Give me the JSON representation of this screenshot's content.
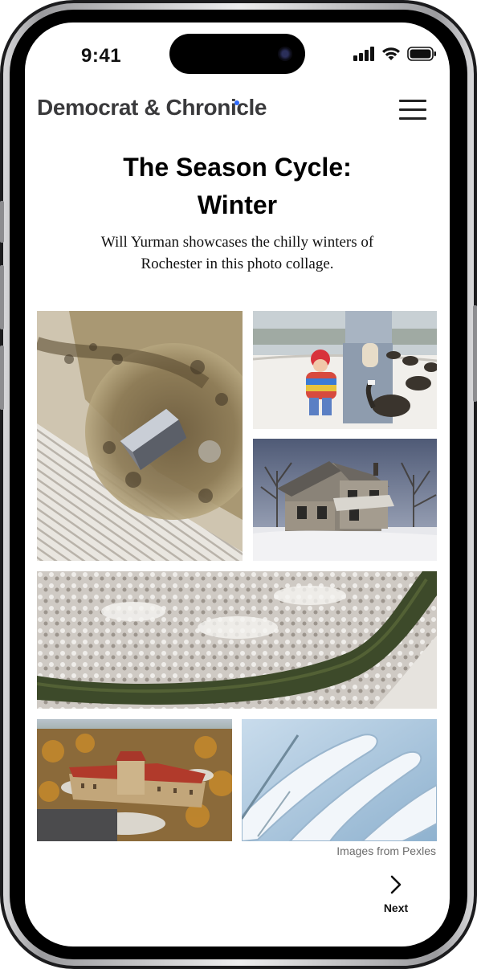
{
  "status_bar": {
    "time": "9:41"
  },
  "header": {
    "brand": "Democrat & Chronicle",
    "menu_icon": "hamburger-menu-icon"
  },
  "article": {
    "title_line1": "The Season Cycle:",
    "title_line2": "Winter",
    "subtitle_line1": "Will Yurman showcases the chilly winters of",
    "subtitle_line2": "Rochester in this photo collage."
  },
  "photos": [
    {
      "name": "aerial-abandoned-farmhouse",
      "subject": "aerial view of abandoned farmhouse in snowy field"
    },
    {
      "name": "child-with-geese",
      "subject": "child in winter coat near geese"
    },
    {
      "name": "old-wooden-house",
      "subject": "weathered wooden house in snow"
    },
    {
      "name": "aerial-river-snowy-forest",
      "subject": "aerial view of river through snowy forest"
    },
    {
      "name": "aerial-historic-building",
      "subject": "aerial view of historic building with red roofs"
    },
    {
      "name": "snow-covered-bench",
      "subject": "close-up of snow on a bench"
    }
  ],
  "credit": "Images from Pexles",
  "navigation": {
    "next_label": "Next",
    "next_icon": "chevron-right-icon"
  }
}
